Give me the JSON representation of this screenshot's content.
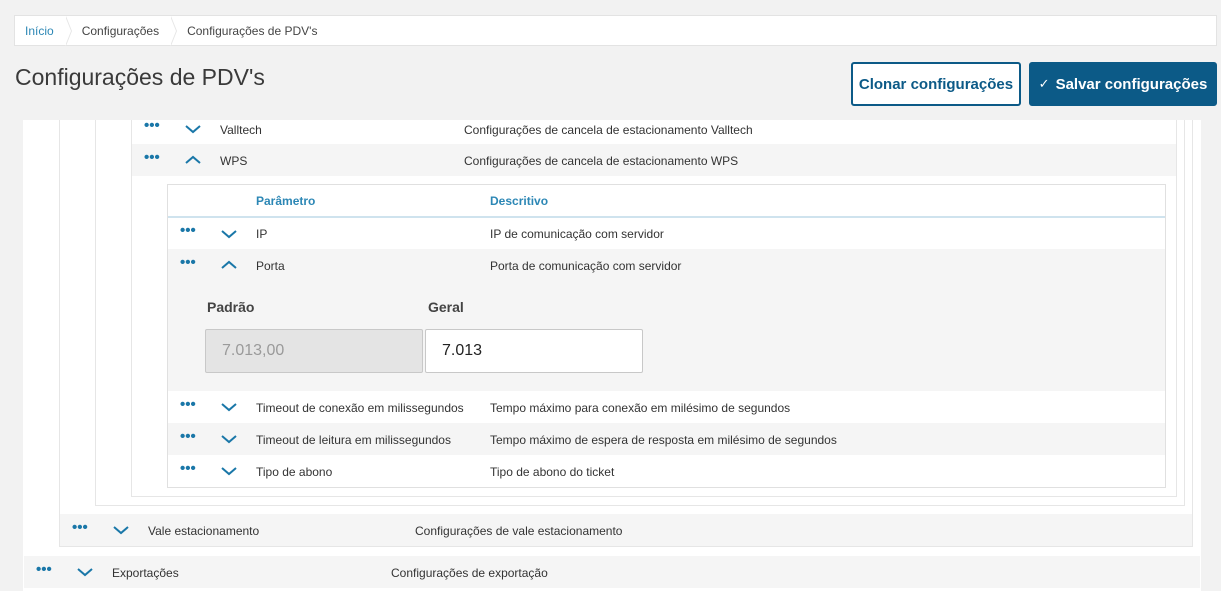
{
  "breadcrumb": [
    "Início",
    "Configurações",
    "Configurações de PDV's"
  ],
  "page_title": "Configurações de PDV's",
  "buttons": {
    "clone": "Clonar configurações",
    "save": "Salvar configurações",
    "save_icon": "✓"
  },
  "parking_rows": [
    {
      "name": "Valltech",
      "desc": "Configurações de cancela de estacionamento Valltech",
      "state": "collapsed"
    },
    {
      "name": "WPS",
      "desc": "Configurações de cancela de estacionamento WPS",
      "state": "expanded"
    }
  ],
  "param_table": {
    "headers": {
      "param": "Parâmetro",
      "desc": "Descritivo"
    },
    "rows": [
      {
        "name": "IP",
        "desc": "IP de comunicação com servidor",
        "state": "collapsed"
      },
      {
        "name": "Porta",
        "desc": "Porta de comunicação com servidor",
        "state": "expanded"
      },
      {
        "name": "Timeout de conexão em milissegundos",
        "desc": "Tempo máximo para conexão em milésimo de segundos",
        "state": "collapsed"
      },
      {
        "name": "Timeout de leitura em milissegundos",
        "desc": "Tempo máximo de espera de resposta em milésimo de segundos",
        "state": "collapsed"
      },
      {
        "name": "Tipo de abono",
        "desc": "Tipo de abono do ticket",
        "state": "collapsed"
      }
    ]
  },
  "porta_detail": {
    "default_label": "Padrão",
    "default_value": "7.013,00",
    "general_label": "Geral",
    "general_value": "7.013"
  },
  "vale_row": {
    "name": "Vale estacionamento",
    "desc": "Configurações de vale estacionamento",
    "state": "collapsed"
  },
  "export_row": {
    "name": "Exportações",
    "desc": "Configurações de exportação",
    "state": "collapsed"
  },
  "icons": {
    "menu": "more-dots-icon",
    "expand": "chevron-down-icon",
    "collapse": "chevron-up-icon"
  },
  "colors": {
    "accent": "#1a77a8",
    "primary_button": "#0c5a87",
    "header_text": "#2c87b5"
  }
}
